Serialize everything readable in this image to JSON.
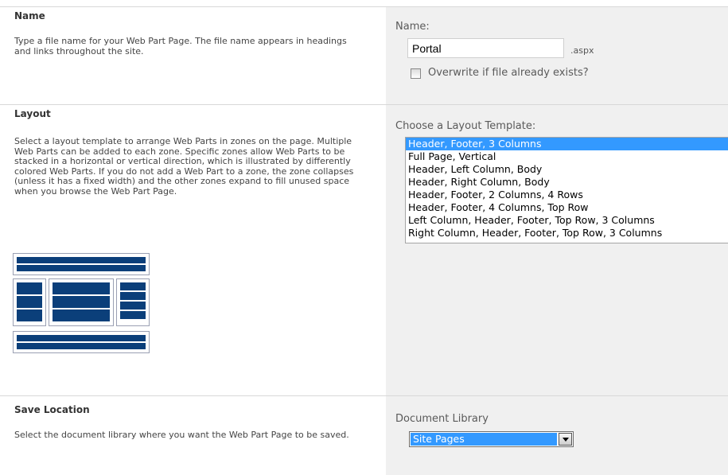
{
  "name_section": {
    "title": "Name",
    "description": "Type a file name for your Web Part Page.  The file name appears in headings and links throughout the site.",
    "field_label": "Name:",
    "filename_value": "Portal",
    "extension": ".aspx",
    "overwrite_label": "Overwrite if file already exists?",
    "overwrite_checked": false
  },
  "layout_section": {
    "title": "Layout",
    "description": "Select a layout template to arrange Web Parts in zones on the page. Multiple Web Parts can be added to each zone. Specific zones allow Web Parts to be stacked in a horizontal or vertical direction, which is illustrated by differently colored Web Parts. If you do not add a Web Part to a zone, the zone collapses (unless it has a fixed width) and the other zones expand to fill unused space when you browse the Web Part Page.",
    "field_label": "Choose a Layout Template:",
    "templates": [
      "Header, Footer, 3 Columns",
      "Full Page, Vertical",
      "Header, Left Column, Body",
      "Header, Right Column, Body",
      "Header, Footer, 2 Columns, 4 Rows",
      "Header, Footer, 4 Columns, Top Row",
      "Left Column, Header, Footer, Top Row, 3 Columns",
      "Right Column, Header, Footer, Top Row, 3 Columns"
    ],
    "selected_index": 0
  },
  "save_section": {
    "title": "Save Location",
    "description": "Select the document library where you want the Web Part Page to be saved.",
    "field_label": "Document Library",
    "library_value": "Site Pages"
  },
  "colors": {
    "selection": "#3399ff",
    "web_part_zone": "#0b3f7a",
    "right_panel": "#f0f0f0"
  }
}
